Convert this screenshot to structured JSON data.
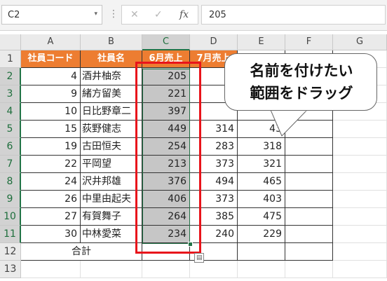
{
  "formula_bar": {
    "name_box": "C2",
    "name_box_arrow": "▾",
    "cancel_glyph": "✕",
    "enter_glyph": "✓",
    "fx_glyph": "fx",
    "formula_value": "205"
  },
  "columns": [
    "A",
    "B",
    "C",
    "D",
    "E",
    "F",
    "G"
  ],
  "rows": [
    "1",
    "2",
    "3",
    "4",
    "5",
    "6",
    "7",
    "8",
    "9",
    "10",
    "11",
    "12",
    "13"
  ],
  "header_row": {
    "a": "社員コード",
    "b": "社員名",
    "c": "6月売上",
    "d": "7月売上"
  },
  "data_rows": [
    {
      "code": "4",
      "name": "酒井柚奈",
      "jun": "205",
      "jul": "",
      "aug": ""
    },
    {
      "code": "9",
      "name": "緒方留美",
      "jun": "221",
      "jul": "",
      "aug": ""
    },
    {
      "code": "10",
      "name": "日比野章二",
      "jun": "397",
      "jul": "",
      "aug": ""
    },
    {
      "code": "15",
      "name": "荻野健志",
      "jun": "449",
      "jul": "314",
      "aug": "43"
    },
    {
      "code": "19",
      "name": "古田恒夫",
      "jun": "254",
      "jul": "283",
      "aug": "318"
    },
    {
      "code": "22",
      "name": "平岡望",
      "jun": "213",
      "jul": "373",
      "aug": "321"
    },
    {
      "code": "24",
      "name": "沢井邦雄",
      "jun": "376",
      "jul": "494",
      "aug": "465"
    },
    {
      "code": "26",
      "name": "中里由起夫",
      "jun": "406",
      "jul": "373",
      "aug": "403"
    },
    {
      "code": "27",
      "name": "有賀舞子",
      "jun": "264",
      "jul": "385",
      "aug": "475"
    },
    {
      "code": "30",
      "name": "中林愛菜",
      "jun": "234",
      "jul": "240",
      "aug": "229"
    }
  ],
  "total_label": "合計",
  "callout": {
    "line1": "名前を付けたい",
    "line2": "範囲をドラッグ"
  },
  "colors": {
    "header_fill": "#ed7d31",
    "selection_green": "#217346",
    "highlight_red": "#e8141b",
    "selection_tint": "#c6c6c6"
  }
}
